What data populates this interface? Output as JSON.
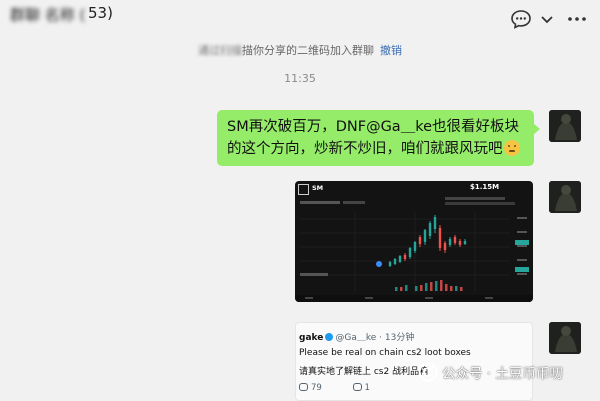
{
  "header": {
    "title_suffix": "53)",
    "icons": [
      "chat-bubble-icon",
      "chevron-down-icon",
      "more-icon"
    ]
  },
  "system_notice": {
    "blurred_prefix": "通过扫描",
    "text": "描你分享的二维码加入群聊",
    "action": "撤销"
  },
  "timestamp": "11:35",
  "message": {
    "text": "SM再次破百万，DNF@Ga＿ke也很看好板块的这个方向，炒新不炒旧，咱们就跟风玩吧",
    "emoji": "flushed-face-emoji"
  },
  "chart_card": {
    "ticker": "SM",
    "price": "$1.15M"
  },
  "tweet_card": {
    "name": "gake",
    "handle": "@Ga＿ke · 13分钟",
    "line1": "Please be real on chain cs2 loot boxes",
    "line2": "请真实地了解链上 cs2 战利品箱",
    "replies": "79",
    "retweets": "1"
  },
  "watermark": {
    "text": "公众号 · 土豆币币叨"
  },
  "colors": {
    "background": "#f1f1f1",
    "bubble": "#95ec69",
    "link": "#3b6db3",
    "card_dark": "#131313"
  }
}
